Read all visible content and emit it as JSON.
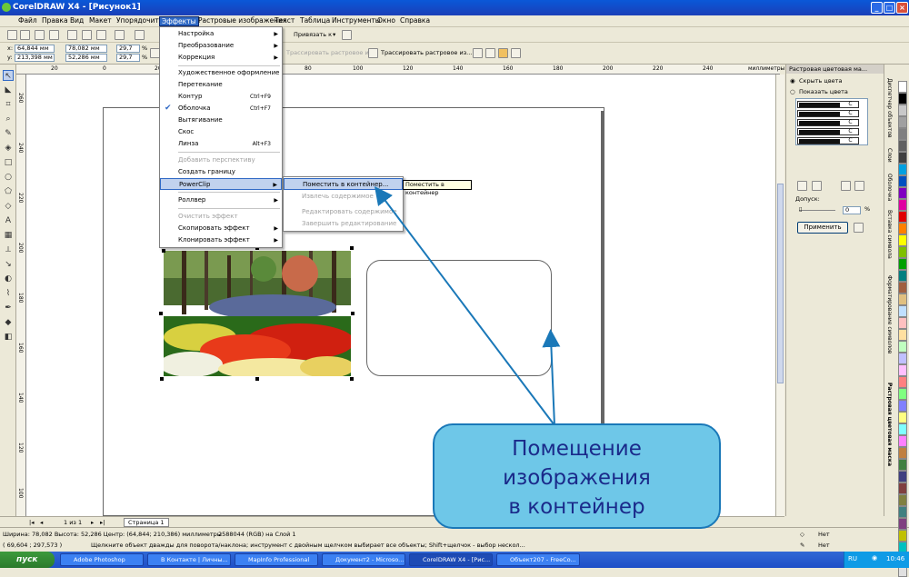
{
  "window": {
    "title": "CorelDRAW X4 - [Рисунок1]"
  },
  "menubar": [
    "Файл",
    "Правка",
    "Вид",
    "Макет",
    "Упорядочить",
    "Эффекты",
    "Растровые изображения",
    "Текст",
    "Таблица",
    "Инструменты",
    "Окно",
    "Справка"
  ],
  "toolbar": {
    "x_label": "x:",
    "x_value": "64,844 мм",
    "y_label": "y:",
    "y_value": "213,398 мм",
    "w_value": "78,082 мм",
    "h_value": "52,286 мм",
    "scale_x": "29,7",
    "scale_y": "29,7",
    "pct": "%",
    "snap_label": "Привязать к",
    "trace_disabled": "Трассировать растровое из...",
    "trace_label": "Трассировать растровое из..."
  },
  "ruler": {
    "h_ticks": [
      "20",
      "0",
      "20",
      "40",
      "60",
      "80",
      "100",
      "120",
      "140",
      "160",
      "180",
      "200",
      "220",
      "240",
      "260"
    ],
    "unit": "миллиметры",
    "v_ticks": [
      "260",
      "240",
      "220",
      "200",
      "180",
      "160",
      "140",
      "120",
      "100",
      "80",
      "60",
      "40",
      "20"
    ]
  },
  "effects_menu": [
    {
      "label": "Настройка",
      "sub": true
    },
    {
      "label": "Преобразование",
      "sub": true
    },
    {
      "label": "Коррекция",
      "sub": true
    },
    {
      "label": "Художественное оформление"
    },
    {
      "label": "Перетекание"
    },
    {
      "label": "Контур",
      "shortcut": "Ctrl+F9"
    },
    {
      "label": "Оболочка",
      "shortcut": "Ctrl+F7",
      "checked": true
    },
    {
      "label": "Вытягивание"
    },
    {
      "label": "Скос"
    },
    {
      "label": "Линза",
      "shortcut": "Alt+F3"
    },
    {
      "label": "Добавить перспективу",
      "disabled": true
    },
    {
      "label": "Создать границу"
    },
    {
      "label": "PowerClip",
      "sub": true,
      "highlight": true
    },
    {
      "label": "Роллвер",
      "sub": true
    },
    {
      "label": "Очистить эффект",
      "disabled": true
    },
    {
      "label": "Скопировать эффект",
      "sub": true
    },
    {
      "label": "Клонировать эффект",
      "sub": true
    }
  ],
  "powerclip_menu": [
    {
      "label": "Поместить в контейнер...",
      "highlight": true
    },
    {
      "label": "Извлечь содержимое",
      "disabled": true
    },
    {
      "label": "Редактировать содержимое",
      "disabled": true
    },
    {
      "label": "Завершить редактирование",
      "disabled": true
    }
  ],
  "tooltip": "Поместить в контейнер",
  "docker": {
    "title": "Растровая цветовая ма...",
    "hide_colors": "Скрыть цвета",
    "show_colors": "Показать цвета",
    "swatch_c": "C",
    "tolerance_label": "Допуск:",
    "tolerance_value": "0",
    "tolerance_unit": "%",
    "apply": "Применить"
  },
  "docker_tabs": [
    "Диспетчер объектов",
    "Слои",
    "Оболочка",
    "Вставка символа",
    "Форматирование символов",
    "Растровая цветовая маска"
  ],
  "palette_colors": [
    "#ffffff",
    "#000000",
    "#c8c8c8",
    "#a0a0a0",
    "#808080",
    "#606060",
    "#404040",
    "#00a0e0",
    "#0050c0",
    "#8000c0",
    "#e000a0",
    "#e00000",
    "#ff8000",
    "#ffff00",
    "#80c000",
    "#00a000",
    "#008080",
    "#a06040",
    "#e0c080",
    "#c0e0ff",
    "#ffc0c0",
    "#ffe0a0",
    "#c0ffc0",
    "#c0c0ff",
    "#ffc0ff",
    "#ff8080",
    "#80ff80",
    "#8080ff",
    "#ffff80",
    "#80ffff",
    "#ff80ff",
    "#c08040",
    "#408040",
    "#404080",
    "#804040",
    "#808040",
    "#408080",
    "#804080",
    "#c0c000",
    "#00c0c0",
    "#c000c0",
    "#e0e0e0"
  ],
  "pagebar": {
    "counter": "1 из 1",
    "page_tab": "Страница 1"
  },
  "status": {
    "line1": "Ширина: 78,082  Высота: 52,286  Центр: (64,844; 210,386)  миллиметры",
    "layer": "2588044 (RGB) на Слой 1",
    "line2_coords": "( 69,604 ; 297,573 )",
    "line2_hint": "Щелкните объект дважды для поворота/наклона; инструмент с двойным щелчком выбирает все объекты; Shift+щелчок - выбор нескол...",
    "fill_none": "Нет",
    "outline_none": "Нет"
  },
  "taskbar": {
    "start": "пуск",
    "tasks": [
      "Adobe Photoshop",
      "В Контакте | Личны...",
      "MapInfo Professional",
      "Документ2 - Microso...",
      "CorelDRAW X4 - [Рис...",
      "Объект207 - FreeCo..."
    ],
    "lang": "RU",
    "clock": "10:46"
  },
  "callout": {
    "lines": [
      "Помещение",
      "изображения",
      "в контейнер"
    ]
  },
  "colors": {
    "accent": "#316ac5",
    "callout_fill": "#6ec7e8",
    "callout_border": "#1a78b8",
    "arrow": "#1a78b8"
  }
}
